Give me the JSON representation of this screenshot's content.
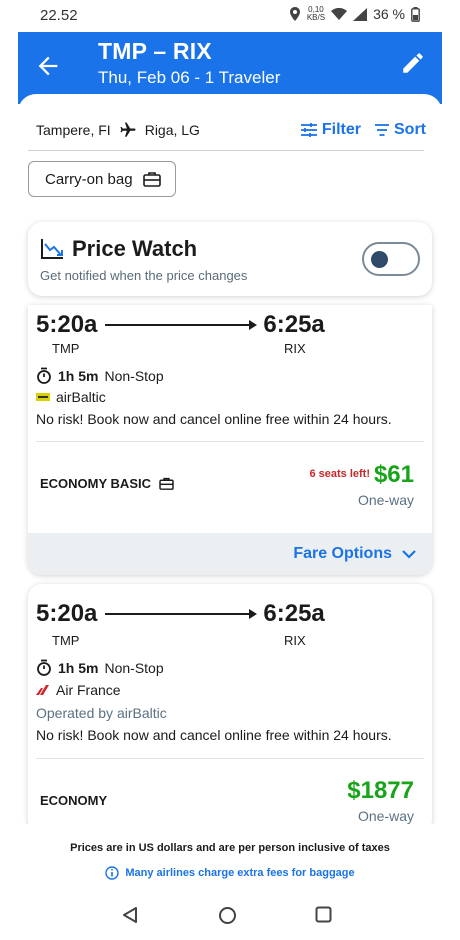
{
  "status_bar": {
    "time": "22.52",
    "speed_value": "0,10",
    "speed_unit": "KB/S",
    "battery": "36 %"
  },
  "header": {
    "title": "TMP – RIX",
    "subtitle": "Thu, Feb 06 - 1 Traveler"
  },
  "route": {
    "origin": "Tampere, FI",
    "destination": "Riga, LG",
    "filter_label": "Filter",
    "sort_label": "Sort"
  },
  "chips": {
    "carry_on": "Carry-on bag"
  },
  "price_watch": {
    "title": "Price Watch",
    "subtitle": "Get notified when the price changes",
    "enabled": false
  },
  "flights": [
    {
      "depart_time": "5:20a",
      "arrive_time": "6:25a",
      "origin_code": "TMP",
      "dest_code": "RIX",
      "duration": "1h 5m",
      "stops": "Non-Stop",
      "airline": "airBaltic",
      "policy": "No risk! Book now and cancel online free within 24 hours.",
      "cabin": "ECONOMY BASIC",
      "seats_left": "6 seats left!",
      "price": "$61",
      "trip_type": "One-way",
      "fare_options": "Fare Options"
    },
    {
      "depart_time": "5:20a",
      "arrive_time": "6:25a",
      "origin_code": "TMP",
      "dest_code": "RIX",
      "duration": "1h 5m",
      "stops": "Non-Stop",
      "airline": "Air France",
      "operated_by": "Operated by airBaltic",
      "policy": "No risk! Book now and cancel online free within 24 hours.",
      "cabin": "ECONOMY",
      "price": "$1877",
      "trip_type": "One-way"
    }
  ],
  "footer": {
    "disclaimer": "Prices are in US dollars and are per person inclusive of taxes",
    "baggage_note": "Many airlines charge extra fees for baggage"
  },
  "colors": {
    "brand_blue": "#1a73e8",
    "price_green": "#18a418",
    "alert_red": "#c62828"
  }
}
